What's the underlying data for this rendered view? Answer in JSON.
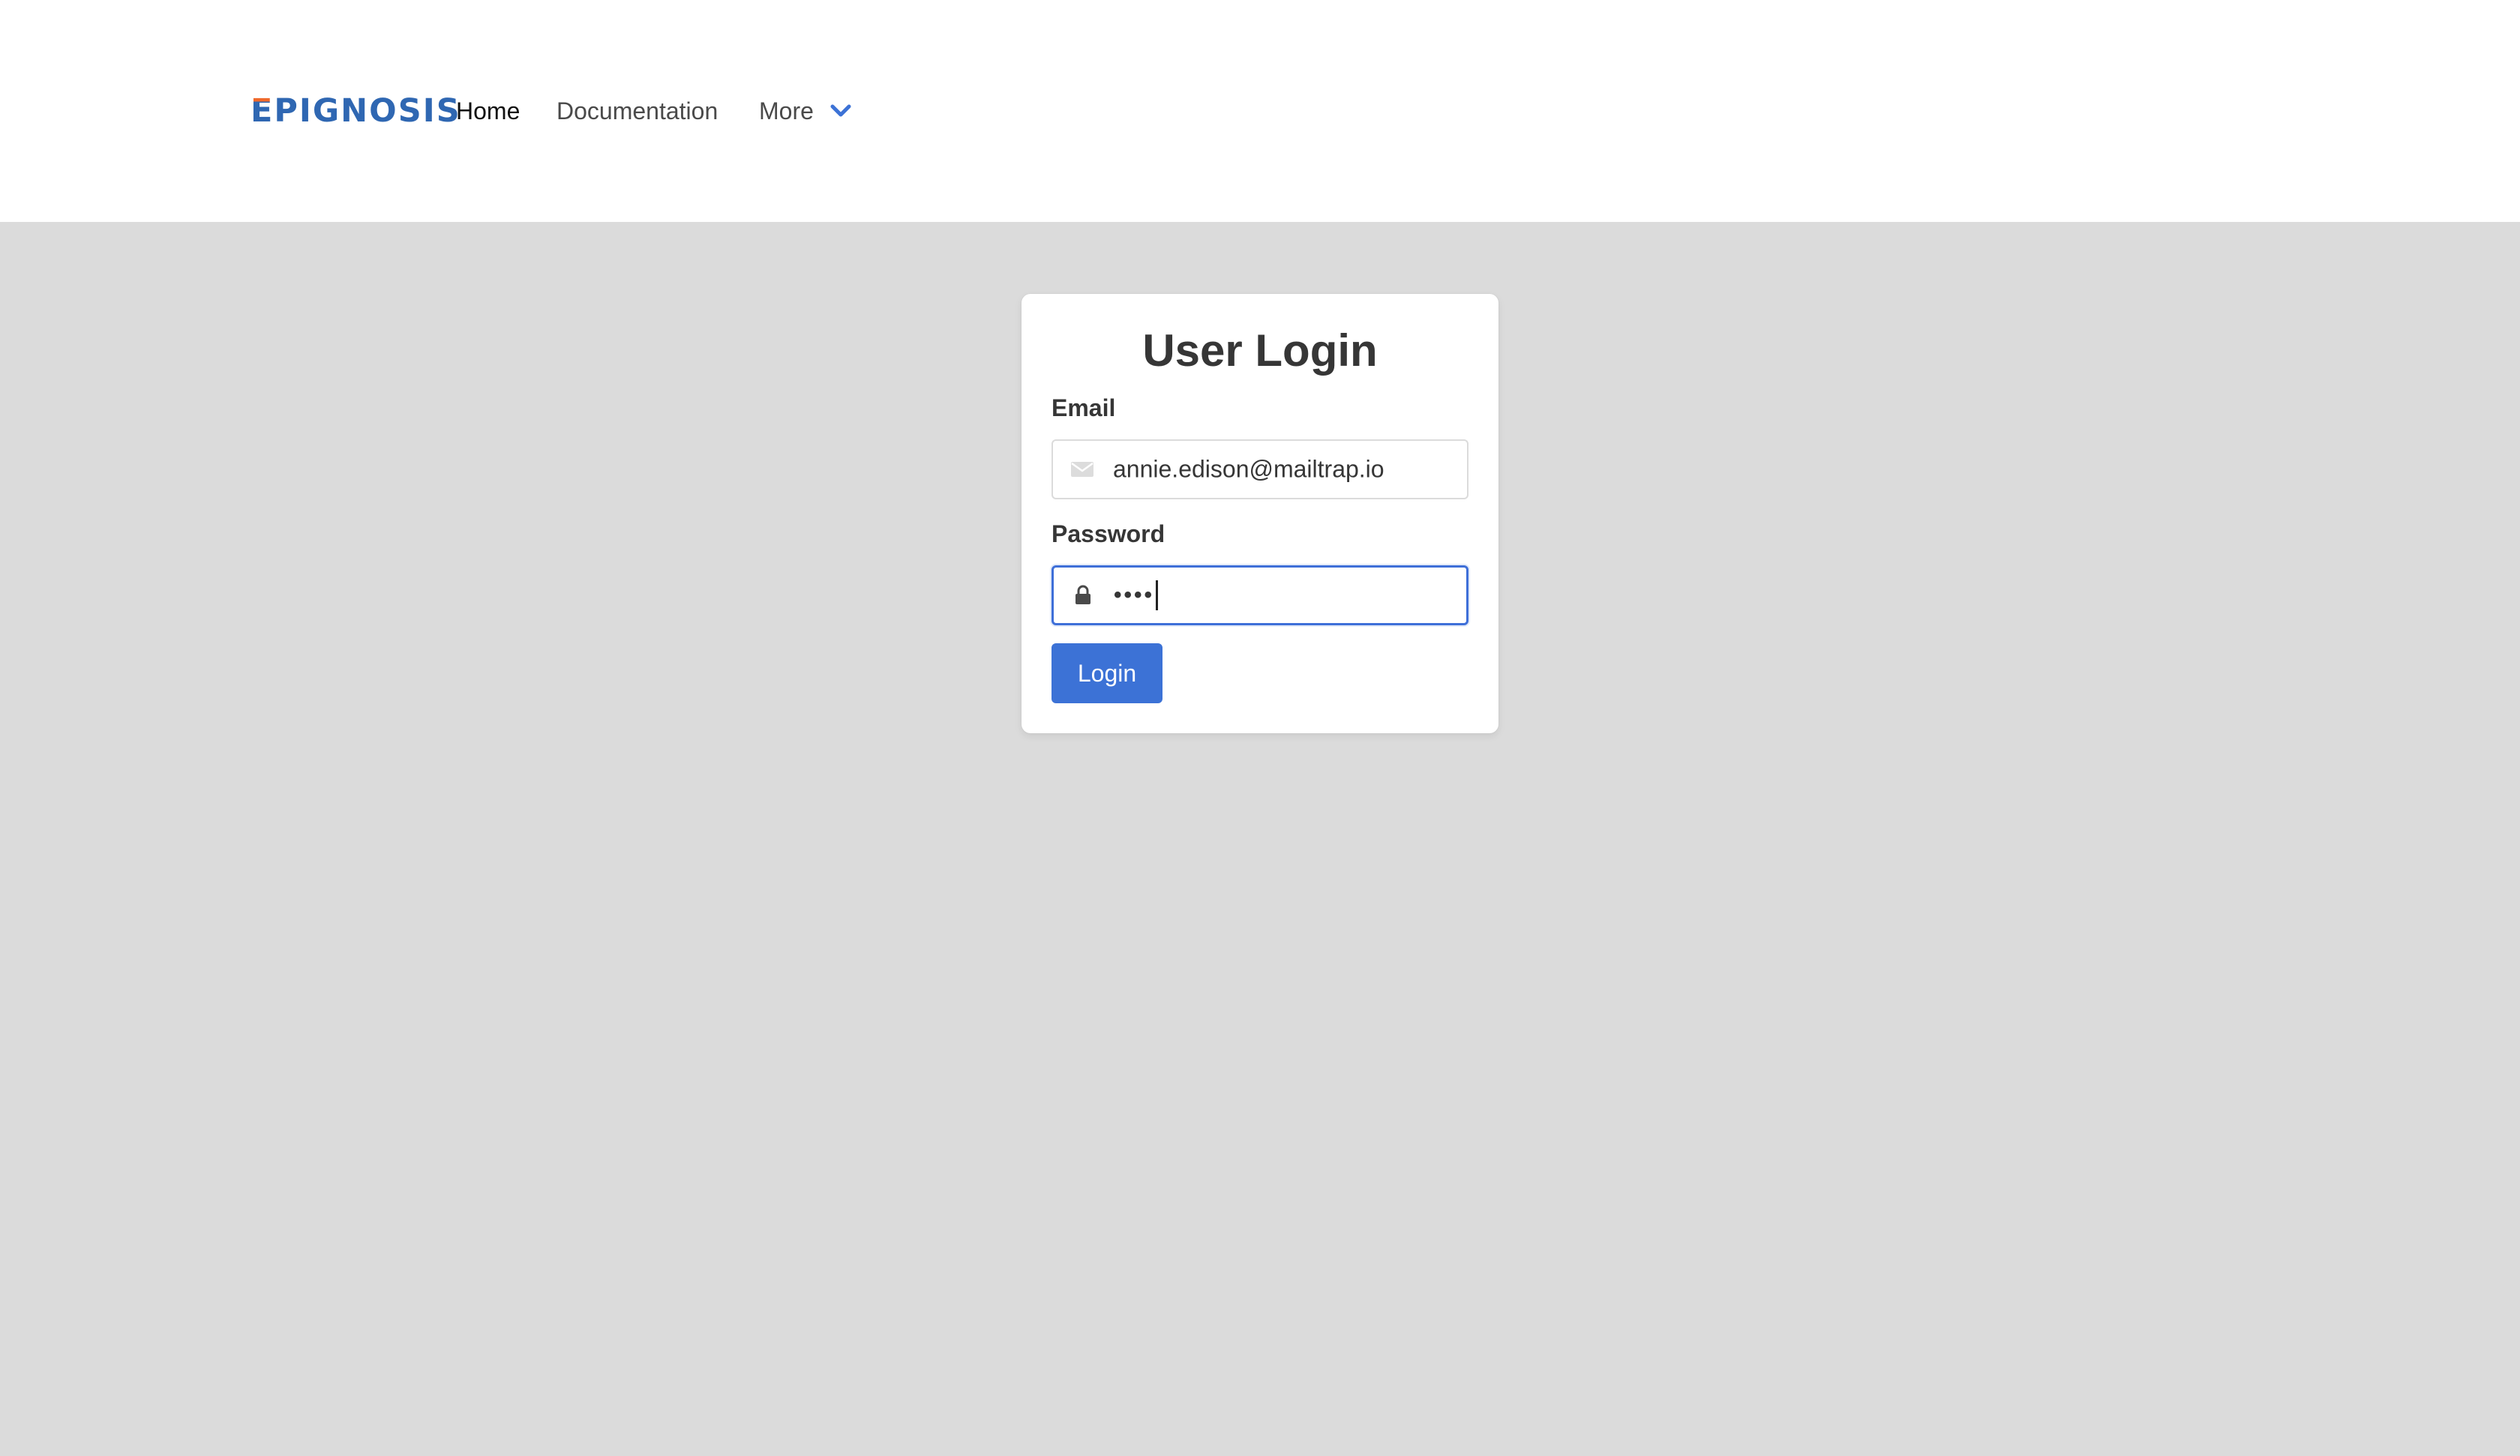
{
  "navbar": {
    "logo_text": "EPIGNOSIS",
    "items": [
      {
        "label": "Home"
      },
      {
        "label": "Documentation"
      },
      {
        "label": "More",
        "icon": "chevron-down-icon"
      }
    ]
  },
  "login": {
    "title": "User Login",
    "email_label": "Email",
    "email_value": "annie.edison@mailtrap.io",
    "email_icon": "envelope-icon",
    "password_label": "Password",
    "password_value": "••••",
    "password_icon": "lock-icon",
    "submit_label": "Login"
  },
  "colors": {
    "accent": "#3c72d6",
    "logo_blue": "#2f67b2",
    "logo_orange": "#f0692b",
    "page_background": "#dbdbdb"
  }
}
